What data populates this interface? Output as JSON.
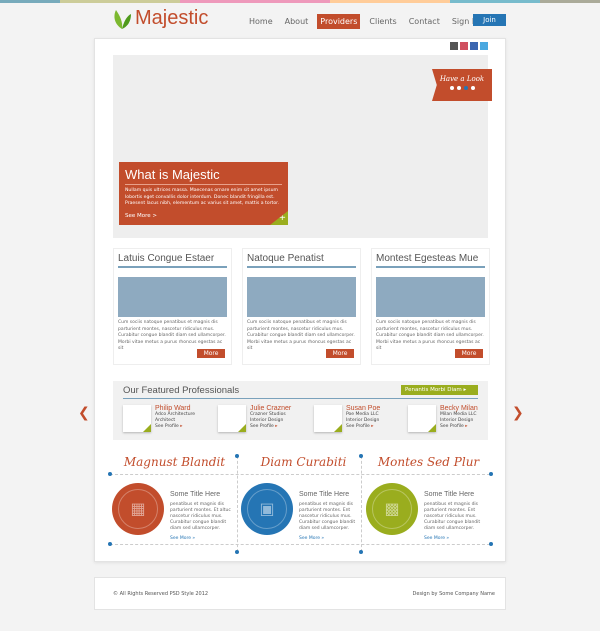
{
  "header": {
    "logo": "Majestic",
    "nav": [
      "Home",
      "About",
      "Providers",
      "Clients",
      "Contact",
      "Sign In"
    ],
    "active_nav": "Providers",
    "join": "Join"
  },
  "social": [
    "google-plus-icon",
    "pinterest-icon",
    "facebook-icon",
    "twitter-icon"
  ],
  "slider": {
    "ribbon": "Have a Look",
    "dots": 4,
    "active_dot": 3,
    "title": "What is Majestic",
    "text": "Nullam quis ultrices massa. Maecenas ornare enim sit amet ipsum lobortis eget convallis dolor interdum. Donec blandit fringilla est. Praesent lacus nibh, elementum ac varius sit amet, mattis a tortor.",
    "see_more": "See More >"
  },
  "cards": [
    {
      "title": "Latuis Congue Estaer",
      "text": "Cum sociis natoque penatibus et magnis dis parturient montes, nascetur ridiculus mus. Curabitur congue blandit diam sed ullamcorper. Morbi vitae metus a purus rhoncus egestas ac sit",
      "more": "More"
    },
    {
      "title": "Natoque Penatist",
      "text": "Cum sociis natoque penatibus et magnis dis parturient montes, nascetur ridiculus mus. Curabitur congue blandit diam sed ullamcorper. Morbi vitae metus a purus rhoncus egestas ac sit",
      "more": "More"
    },
    {
      "title": "Montest Egesteas Mue",
      "text": "Cum sociis natoque penatibus et magnis dis parturient montes, nascetur ridiculus mus. Curabitur congue blandit diam sed ullamcorper. Morbi vitae metus a purus rhoncus egestas ac sit",
      "more": "More"
    }
  ],
  "featured": {
    "title": "Our Featured Professionals",
    "button": "Penantis Morbi Diam",
    "people": [
      {
        "name": "Philip Ward",
        "company": "Adco Architecture",
        "role": "Architect",
        "link": "See Profile"
      },
      {
        "name": "Julie Crazner",
        "company": "Crazner Studios",
        "role": "Interior Design",
        "link": "See Profile"
      },
      {
        "name": "Susan Poe",
        "company": "Poe Media LLC",
        "role": "Interior Design",
        "link": "See Profile"
      },
      {
        "name": "Becky Milan",
        "company": "Milan Media LLC",
        "role": "Interior Design",
        "link": "See Profile"
      }
    ]
  },
  "services": [
    {
      "heading": "Magnust Blandit",
      "icon": "buildings-icon",
      "color": "#c24d2c",
      "title": "Some Title Here",
      "text": "penatibus et magnis dis parturient montes. Et altuc nascetur ridiculus mus. Curabitur congue blandit diam sed ullamcorper.",
      "link": "See More »"
    },
    {
      "heading": "Diam Curabiti",
      "icon": "tablet-icon",
      "color": "#2575b4",
      "title": "Some Title Here",
      "text": "penatibus et magnis dis parturient montes. Ent nascetur ridiculus mus. Curabitur congue blandit diam sed ullamcorper.",
      "link": "See More »"
    },
    {
      "heading": "Montes Sed Plur",
      "icon": "monitor-icon",
      "color": "#9aad1e",
      "title": "Some Title Here",
      "text": "penatibus et magnis dis parturient montes. Ent nascetur ridiculus mus. Curabitur congue blandit diam sed ullamcorper.",
      "link": "See More »"
    }
  ],
  "footer": {
    "left": "© All Rights Reserved PSD Style 2012",
    "right": "Design by Some Company Name"
  },
  "colors": {
    "accent": "#c24d2c",
    "blue": "#2575b4",
    "green": "#9aad1e"
  }
}
